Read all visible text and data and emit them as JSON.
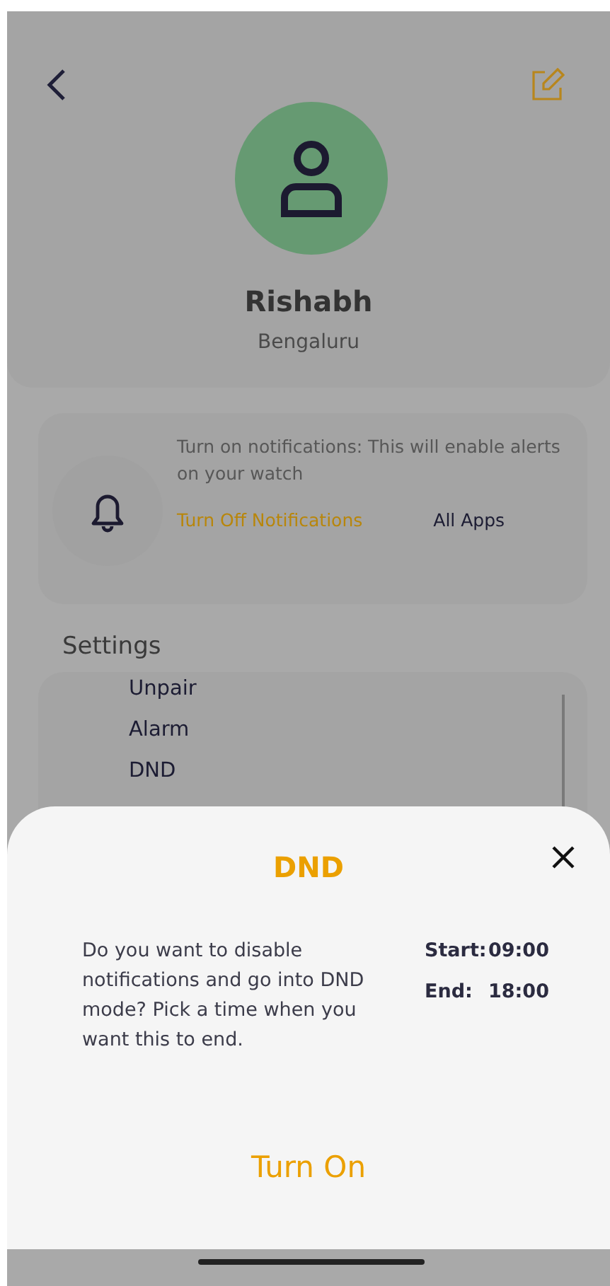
{
  "profile": {
    "name": "Rishabh",
    "city": "Bengaluru"
  },
  "notifications": {
    "message": "Turn on notifications: This will enable alerts on your watch",
    "actions": [
      {
        "label": "Turn Off Notifications",
        "kind": "accent"
      },
      {
        "label": "All Apps",
        "kind": "plain"
      }
    ]
  },
  "settings": {
    "title": "Settings",
    "items": [
      "Unpair",
      "Alarm",
      "DND"
    ]
  },
  "dialog": {
    "title": "DND",
    "message": "Do you want to disable notifications and go into DND mode? Pick a time when you want this to end.",
    "times": [
      {
        "label": "Start:",
        "value": "09:00"
      },
      {
        "label": "End:",
        "value": "18:00"
      }
    ],
    "action": "Turn On"
  }
}
